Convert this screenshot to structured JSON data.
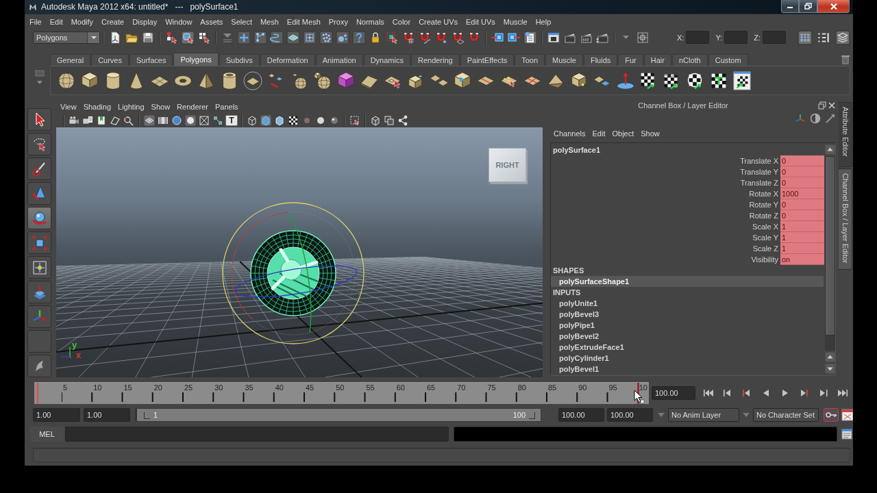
{
  "window": {
    "title": "Autodesk Maya 2012 x64: untitled*   ---   polySurface1"
  },
  "menu_bar": [
    "File",
    "Edit",
    "Modify",
    "Create",
    "Display",
    "Window",
    "Assets",
    "Select",
    "Mesh",
    "Edit Mesh",
    "Proxy",
    "Normals",
    "Color",
    "Create UVs",
    "Edit UVs",
    "Muscle",
    "Help"
  ],
  "status_line": {
    "menu_set": "Polygons",
    "coordinate_fields": [
      {
        "label": "X:"
      },
      {
        "label": "Y:"
      },
      {
        "label": "Z:"
      }
    ]
  },
  "shelf": {
    "tabs": [
      {
        "label": "General",
        "selected": false
      },
      {
        "label": "Curves",
        "selected": false
      },
      {
        "label": "Surfaces",
        "selected": false
      },
      {
        "label": "Polygons",
        "selected": true
      },
      {
        "label": "Subdivs",
        "selected": false
      },
      {
        "label": "Deformation",
        "selected": false
      },
      {
        "label": "Animation",
        "selected": false
      },
      {
        "label": "Dynamics",
        "selected": false
      },
      {
        "label": "Rendering",
        "selected": false
      },
      {
        "label": "PaintEffects",
        "selected": false
      },
      {
        "label": "Toon",
        "selected": false
      },
      {
        "label": "Muscle",
        "selected": false
      },
      {
        "label": "Fluids",
        "selected": false
      },
      {
        "label": "Fur",
        "selected": false
      },
      {
        "label": "Hair",
        "selected": false
      },
      {
        "label": "nCloth",
        "selected": false
      },
      {
        "label": "Custom",
        "selected": false
      }
    ]
  },
  "toolbox": [
    {
      "selected": false
    },
    {
      "selected": false
    },
    {
      "selected": false
    },
    {
      "selected": false
    },
    {
      "selected": true
    },
    {
      "selected": false
    },
    {
      "selected": false
    },
    {
      "selected": false
    },
    {
      "selected": false
    },
    {
      "selected": false
    },
    {
      "selected": false
    }
  ],
  "viewport": {
    "menu": [
      "View",
      "Shading",
      "Lighting",
      "Show",
      "Renderer",
      "Panels"
    ],
    "texture_toggle": "T",
    "view_cube": "RIGHT",
    "axis_labels": [
      {
        "label": "y",
        "color": "#3cc83c"
      },
      {
        "label": "x",
        "color": "#d83a3a"
      }
    ]
  },
  "channel_box": {
    "title": "Channel Box / Layer Editor",
    "menu": [
      "Channels",
      "Edit",
      "Object",
      "Show"
    ],
    "object": "polySurface1",
    "channels": [
      {
        "name": "Translate X",
        "value": "0",
        "keyed": true
      },
      {
        "name": "Translate Y",
        "value": "0",
        "keyed": true
      },
      {
        "name": "Translate Z",
        "value": "0",
        "keyed": true
      },
      {
        "name": "Rotate X",
        "value": "1000",
        "keyed": true
      },
      {
        "name": "Rotate Y",
        "value": "0",
        "keyed": true
      },
      {
        "name": "Rotate Z",
        "value": "0",
        "keyed": true
      },
      {
        "name": "Scale X",
        "value": "1",
        "keyed": true
      },
      {
        "name": "Scale Y",
        "value": "1",
        "keyed": true
      },
      {
        "name": "Scale Z",
        "value": "1",
        "keyed": true
      },
      {
        "name": "Visibility",
        "value": "on",
        "keyed": true
      }
    ],
    "shapes": {
      "heading": "SHAPES",
      "items": [
        {
          "name": "polySurfaceShape1",
          "selected": true
        }
      ]
    },
    "inputs": {
      "heading": "INPUTS",
      "items": [
        {
          "name": "polyUnite1",
          "selected": false
        },
        {
          "name": "polyBevel3",
          "selected": false
        },
        {
          "name": "polyPipe1",
          "selected": false
        },
        {
          "name": "polyBevel2",
          "selected": false
        },
        {
          "name": "polyExtrudeFace1",
          "selected": false
        },
        {
          "name": "polyCylinder1",
          "selected": false
        },
        {
          "name": "polyBevel1",
          "selected": false
        }
      ]
    }
  },
  "side_tabs": [
    {
      "label": "Attribute Editor",
      "selected": false
    },
    {
      "label": "Channel Box / Layer Editor",
      "selected": true
    }
  ],
  "time_slider": {
    "ticks": [
      "5",
      "10",
      "15",
      "20",
      "25",
      "30",
      "35",
      "40",
      "45",
      "50",
      "55",
      "60",
      "65",
      "70",
      "75",
      "80",
      "85",
      "90",
      "95",
      "10"
    ],
    "markers": [
      {
        "kind": "key",
        "level": 0
      },
      {
        "kind": "current",
        "level": 1
      }
    ],
    "current_time": "100.00"
  },
  "range_slider": {
    "start_time": "1.00",
    "range_start": "1.00",
    "handle_start": "1",
    "handle_end": "100",
    "range_end": "100.00",
    "end_time": "100.00",
    "anim_layer": "No Anim Layer",
    "character_set": "No Character Set"
  },
  "command_line": {
    "language": "MEL"
  }
}
